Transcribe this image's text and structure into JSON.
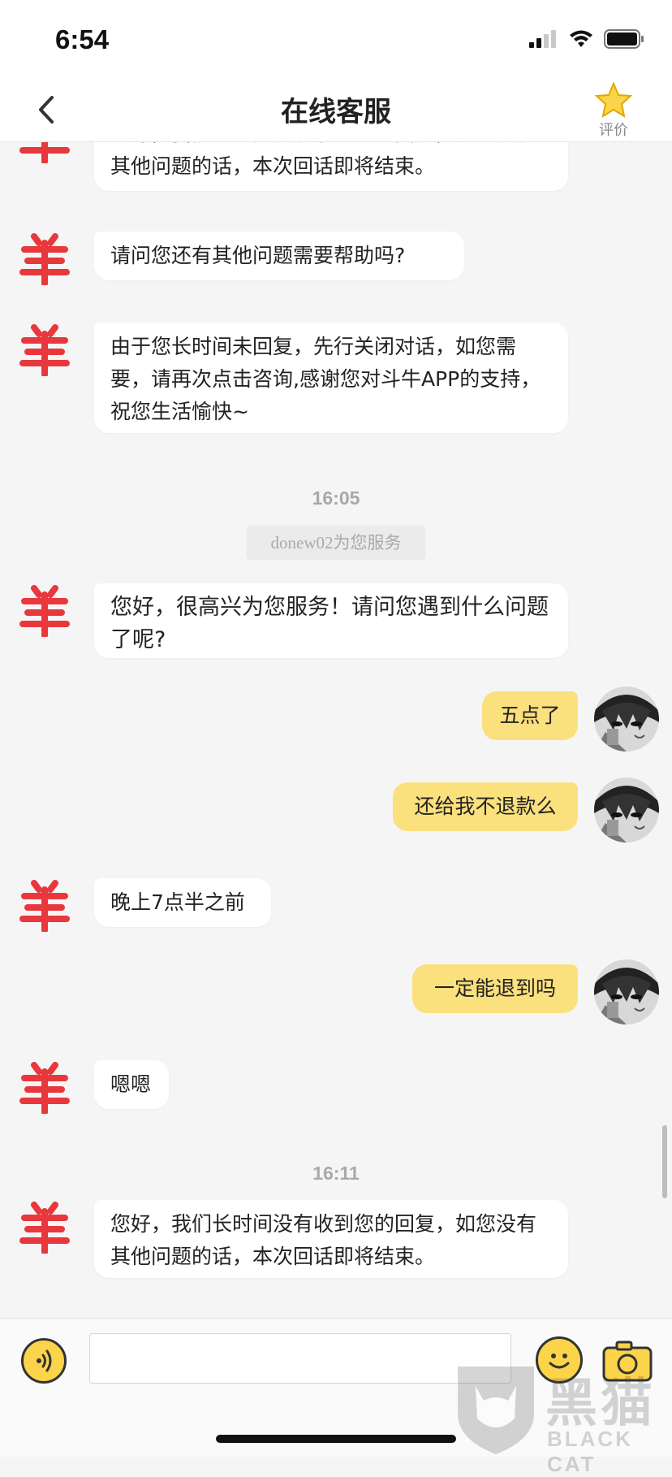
{
  "status_bar": {
    "time": "6:54"
  },
  "header": {
    "title": "在线客服",
    "rate_label": "评价"
  },
  "messages": [
    {
      "from": "agent",
      "text": "您好，我们长时间没有收到您的回复，如您没有其他问题的话，本次回话即将结束。"
    },
    {
      "from": "agent",
      "text": "请问您还有其他问题需要帮助吗?"
    },
    {
      "from": "agent",
      "text": "由于您长时间未回复，先行关闭对话，如您需要，请再次点击咨询,感谢您对斗牛APP的支持，祝您生活愉快~"
    },
    {
      "from": "time",
      "text": "16:05"
    },
    {
      "from": "system",
      "text": "donew02为您服务"
    },
    {
      "from": "agent",
      "text": "您好，很高兴为您服务！请问您遇到什么问题了呢?"
    },
    {
      "from": "user",
      "text": "五点了"
    },
    {
      "from": "user",
      "text": "还给我不退款么"
    },
    {
      "from": "agent",
      "text": "晚上7点半之前"
    },
    {
      "from": "user",
      "text": "一定能退到吗"
    },
    {
      "from": "agent",
      "text": "嗯嗯"
    },
    {
      "from": "time",
      "text": "16:11"
    },
    {
      "from": "agent",
      "text": "您好，我们长时间没有收到您的回复，如您没有其他问题的话，本次回话即将结束。"
    }
  ],
  "composer": {
    "value": "",
    "placeholder": ""
  },
  "watermark": {
    "text": "黑猫",
    "sub": "BLACK CAT"
  },
  "colors": {
    "user_bubble": "#fbe07e",
    "accent": "#fbd44a",
    "agent_icon": "#e8383d"
  },
  "icons": [
    "back-icon",
    "star-icon",
    "voice-icon",
    "emoji-icon",
    "camera-icon",
    "agent-avatar-icon",
    "user-avatar"
  ]
}
